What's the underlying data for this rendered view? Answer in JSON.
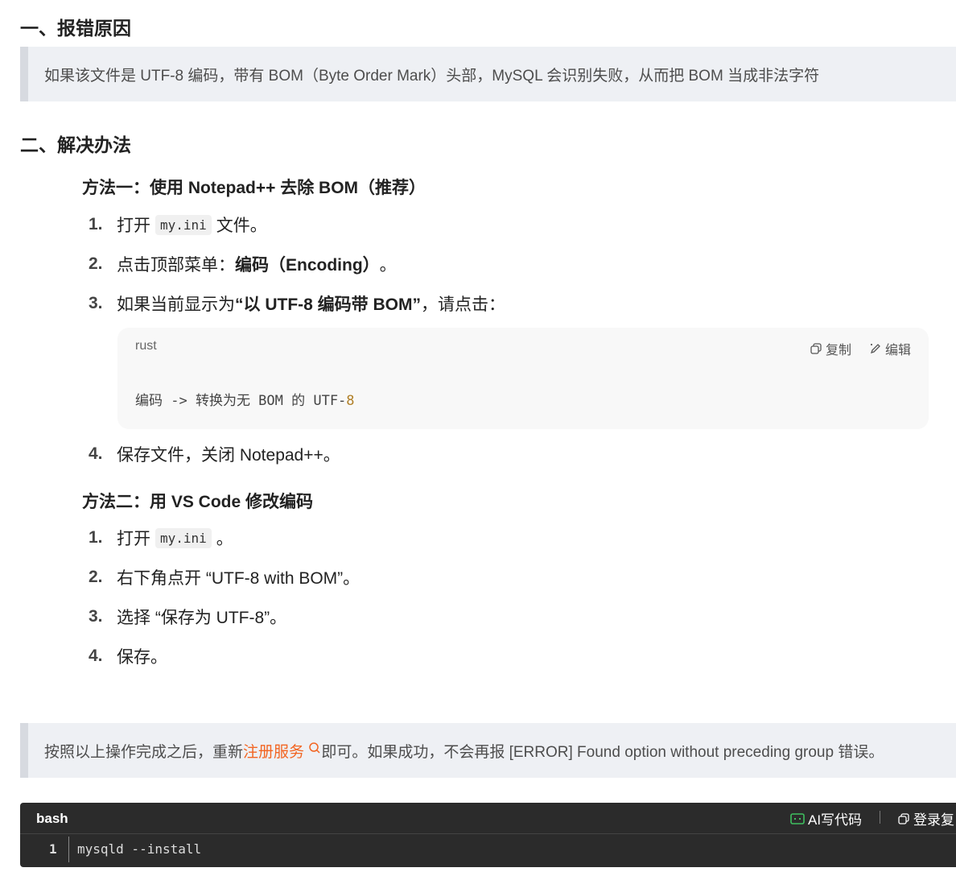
{
  "section1": {
    "heading": "一、报错原因",
    "quote": "如果该文件是 UTF-8 编码，带有 BOM（Byte Order Mark）头部，MySQL 会识别失败，从而把 BOM 当成非法字符"
  },
  "section2": {
    "heading": "二、解决办法",
    "method1": {
      "title": "方法一：使用 Notepad++ 去除 BOM（推荐）",
      "steps": [
        {
          "num": "1.",
          "pre": "打开",
          "code": "my.ini",
          "post": "文件。"
        },
        {
          "num": "2.",
          "pre": "点击顶部菜单：",
          "bold": "编码（Encoding）",
          "post": "。"
        },
        {
          "num": "3.",
          "pre": "如果当前显示为 ",
          "bold": "“以 UTF-8 编码带 BOM”",
          "post": "，请点击："
        },
        {
          "num": "4.",
          "pre": "保存文件，关闭 Notepad++。"
        }
      ],
      "codeblock": {
        "lang": "rust",
        "copy_label": "复制",
        "edit_label": "编辑",
        "code_text": "编码 -> 转换为无 BOM 的 UTF-",
        "code_number": "8"
      }
    },
    "method2": {
      "title": "方法二：用 VS Code 修改编码",
      "steps": [
        {
          "num": "1.",
          "pre": "打开",
          "code": "my.ini",
          "post": "。"
        },
        {
          "num": "2.",
          "pre": "右下角点开 “UTF-8 with BOM”。"
        },
        {
          "num": "3.",
          "pre": "选择 “保存为 UTF-8”。"
        },
        {
          "num": "4.",
          "pre": "保存。"
        }
      ]
    }
  },
  "final_note": {
    "pre": "按照以上操作完成之后，重新",
    "link": "注册服务",
    "post": "即可。如果成功，不会再报 [ERROR] Found option without preceding group 错误。"
  },
  "bash_block": {
    "lang": "bash",
    "ai_label": "AI写代码",
    "login_label": "登录复",
    "line_number": "1",
    "command": "mysqld --install"
  },
  "colors": {
    "link": "#f26522",
    "quote_bg": "#eef0f4",
    "dark_bg": "#2b2b2b",
    "ai_green": "#3fbf5f"
  }
}
